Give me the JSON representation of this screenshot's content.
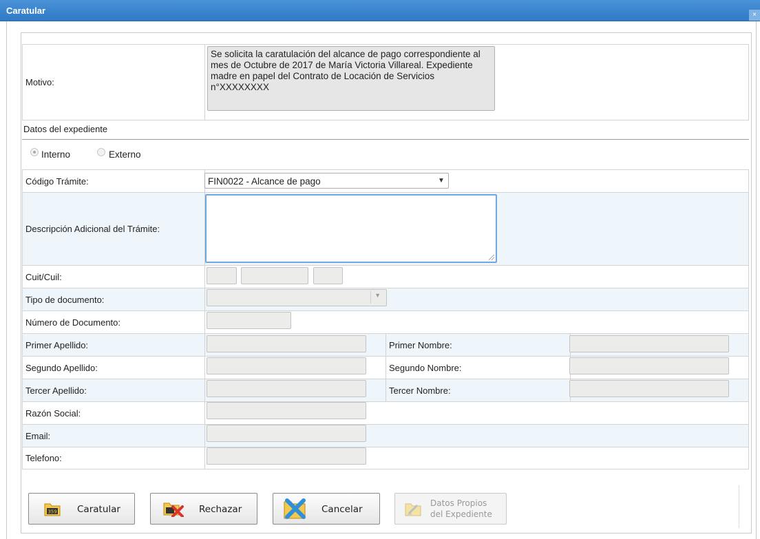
{
  "window": {
    "title": "Caratular",
    "close_icon": "×"
  },
  "motivo": {
    "label": "Motivo:",
    "text": "Se solicita la caratulación del alcance de pago correspondiente al mes de Octubre de 2017 de María Victoria Villareal. Expediente madre en papel del Contrato de Locación de Servicios n°XXXXXXXX"
  },
  "section_title": "Datos del expediente",
  "radios": {
    "interno": "Interno",
    "externo": "Externo",
    "selected": "interno"
  },
  "form": {
    "codigo_tramite": {
      "label": "Código Trámite:",
      "value": "FIN0022 - Alcance de pago"
    },
    "descripcion": {
      "label": "Descripción Adicional del Trámite:",
      "value": ""
    },
    "cuit": {
      "label": "Cuit/Cuil:"
    },
    "tipo_doc": {
      "label": "Tipo de documento:"
    },
    "numero_doc": {
      "label": "Número de Documento:"
    },
    "primer_apellido": {
      "label": "Primer Apellido:"
    },
    "primer_nombre": {
      "label": "Primer Nombre:"
    },
    "segundo_apellido": {
      "label": "Segundo Apellido:"
    },
    "segundo_nombre": {
      "label": "Segundo Nombre:"
    },
    "tercer_apellido": {
      "label": "Tercer Apellido:"
    },
    "tercer_nombre": {
      "label": "Tercer Nombre:"
    },
    "razon_social": {
      "label": "Razón Social:"
    },
    "email": {
      "label": "Email:"
    },
    "telefono": {
      "label": "Telefono:"
    }
  },
  "buttons": {
    "caratular": "Caratular",
    "rechazar": "Rechazar",
    "cancelar": "Cancelar",
    "datos_propios_1": "Datos Propios",
    "datos_propios_2": "del Expediente",
    "icon_badge": "359"
  }
}
